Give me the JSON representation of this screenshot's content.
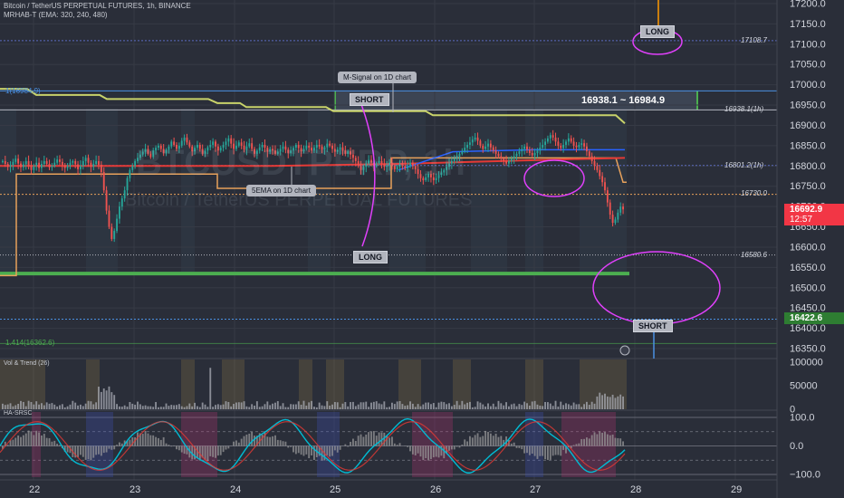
{
  "header": {
    "symbol_line": "Bitcoin / TetherUS PERPETUAL FUTURES, 1h, BINANCE",
    "indicator_line": "MRHAB-T (EMA: 320, 240, 480)"
  },
  "watermark": {
    "ticker": "BTCUSDTPERP, 1h",
    "name": "Bitcoin / TetherUS PERPETUAL FUTURES"
  },
  "colors": {
    "background": "#2a2e39",
    "up_candle": "#26a69a",
    "down_candle": "#ef5350",
    "m_signal": "#c9d36a",
    "sema": "#e8a15b",
    "support": "#4caf50",
    "annotation": "#e040fb",
    "osc_line": "#00bcd4"
  },
  "price_axis": {
    "ticks": [
      "17200.0",
      "17150.0",
      "17100.0",
      "17050.0",
      "17000.0",
      "16950.0",
      "16900.0",
      "16850.0",
      "16800.0",
      "16750.0",
      "16700.0",
      "16650.0",
      "16600.0",
      "16550.0",
      "16500.0",
      "16450.0",
      "16400.0",
      "16350.0"
    ],
    "current_price": "16692.9",
    "countdown": "12:57",
    "marker_price": "16422.6"
  },
  "time_axis": {
    "ticks": [
      "22",
      "23",
      "24",
      "25",
      "26",
      "27",
      "28",
      "29"
    ]
  },
  "levels": [
    {
      "label": "17108.7",
      "price": 17108.7
    },
    {
      "label": "16938.1(1h)",
      "price": 16938.1
    },
    {
      "label": "16801.2(1h)",
      "price": 16801.2
    },
    {
      "label": "16730.0",
      "price": 16730.0
    },
    {
      "label": "16580.6",
      "price": 16580.6
    }
  ],
  "fib": {
    "top": "1(16984.9)",
    "bottom": "1.414(16362.6)"
  },
  "range_box": {
    "label": "16938.1 ~ 16984.9"
  },
  "tags": {
    "long_top": "LONG",
    "short_top": "SHORT",
    "long_mid": "LONG",
    "short_bottom": "SHORT"
  },
  "callouts": {
    "m_signal": "M-Signal on 1D chart",
    "sema": "5EMA on 1D chart"
  },
  "volume_panel": {
    "title": "Vol & Trend (26)",
    "ticks": [
      "100000",
      "50000",
      "0"
    ]
  },
  "osc_panel": {
    "title": "HA-SRSC",
    "ticks": [
      "100.0",
      "0.0",
      "−100.0"
    ]
  },
  "chart_data": {
    "type": "candlestick",
    "interval": "1h",
    "ylim": [
      16330,
      17220
    ],
    "x_ticks": [
      "22",
      "23",
      "24",
      "25",
      "26",
      "27",
      "28",
      "29"
    ],
    "closes": [
      16812,
      16805,
      16798,
      16802,
      16810,
      16818,
      16806,
      16797,
      16804,
      16812,
      16800,
      16790,
      16800,
      16808,
      16795,
      16805,
      16812,
      16805,
      16797,
      16800,
      16808,
      16816,
      16810,
      16802,
      16795,
      16800,
      16808,
      16812,
      16804,
      16792,
      16800,
      16812,
      16820,
      16808,
      16798,
      16805,
      16812,
      16803,
      16785,
      16740,
      16690,
      16650,
      16620,
      16640,
      16670,
      16700,
      16720,
      16740,
      16770,
      16790,
      16800,
      16812,
      16820,
      16828,
      16835,
      16842,
      16830,
      16822,
      16838,
      16845,
      16850,
      16842,
      16832,
      16840,
      16848,
      16860,
      16852,
      16842,
      16850,
      16862,
      16870,
      16858,
      16848,
      16836,
      16845,
      16852,
      16842,
      16830,
      16838,
      16846,
      16852,
      16860,
      16848,
      16838,
      16845,
      16852,
      16860,
      16868,
      16855,
      16842,
      16850,
      16858,
      16850,
      16840,
      16848,
      16856,
      16842,
      16830,
      16838,
      16846,
      16852,
      16845,
      16835,
      16842,
      16838,
      16830,
      16835,
      16842,
      16848,
      16840,
      16832,
      16838,
      16845,
      16852,
      16844,
      16836,
      16842,
      16850,
      16845,
      16838,
      16845,
      16852,
      16848,
      16840,
      16846,
      16855,
      16850,
      16842,
      16835,
      16840,
      16846,
      16838,
      16830,
      16836,
      16828,
      16820,
      16812,
      16800,
      16790,
      16798,
      16806,
      16815,
      16808,
      16800,
      16806,
      16812,
      16805,
      16798,
      16802,
      16808,
      16800,
      16792,
      16798,
      16804,
      16800,
      16794,
      16800,
      16808,
      16800,
      16792,
      16780,
      16770,
      16765,
      16772,
      16780,
      16772,
      16765,
      16770,
      16778,
      16784,
      16790,
      16798,
      16806,
      16812,
      16818,
      16824,
      16830,
      16836,
      16845,
      16852,
      16858,
      16865,
      16870,
      16862,
      16850,
      16842,
      16848,
      16855,
      16846,
      16838,
      16830,
      16824,
      16818,
      16812,
      16806,
      16812,
      16818,
      16824,
      16830,
      16836,
      16842,
      16848,
      16840,
      16832,
      16826,
      16832,
      16838,
      16845,
      16852,
      16860,
      16868,
      16876,
      16870,
      16860,
      16850,
      16844,
      16852,
      16860,
      16868,
      16860,
      16850,
      16846,
      16852,
      16856,
      16848,
      16836,
      16824,
      16812,
      16800,
      16790,
      16775,
      16760,
      16740,
      16710,
      16680,
      16660,
      16668,
      16685,
      16700,
      16693
    ]
  }
}
